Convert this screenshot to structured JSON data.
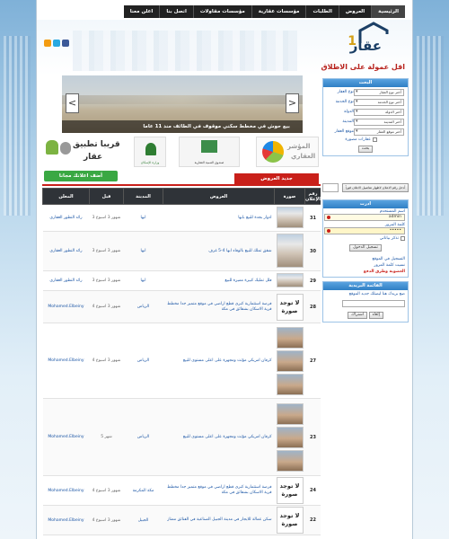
{
  "nav": {
    "items": [
      "الرئيسية",
      "العروض",
      "الطلبات",
      "مؤسسات عقارية",
      "مؤسسات مقاولات",
      "اتصل بنا",
      "اعلن معنا"
    ]
  },
  "header": {
    "logo_text": "عقار",
    "logo_number": "1",
    "slogan": "اقل عمولة على الاطلاق"
  },
  "slider": {
    "caption": "بيع حوش في مخطط سكني موقوف في الطائف منذ 11 عاما",
    "prev_arrow": "<",
    "next_arrow": ">"
  },
  "promos": {
    "app_line1": "قريبا تطبيق",
    "app_line2": "عقار",
    "seal1_caption": "وزارة الإسكان",
    "seal2_caption": "صندوق التنمية العقارية",
    "index_line1": "المؤشر",
    "index_line2": "العقاري",
    "free_ad_button": "أضف اعلانك مجانا",
    "new_offers": "جديد العروض"
  },
  "table": {
    "headers": [
      "رقم الإعلان",
      "صورة",
      "العروض",
      "المدينة",
      "قبل",
      "المعلن"
    ],
    "rows": [
      {
        "id": "31",
        "image": "photo",
        "title": "ادوار بجدة للبيع بابها",
        "city": "ابها",
        "ago": "3 شهور 3 اسبوع",
        "seller": "رائد التطور العقاري"
      },
      {
        "id": "30",
        "image": "photo",
        "title": "شقق تملك للبيع بالوفاء ابها 4-5 غرف",
        "city": "ابها",
        "ago": "3 شهور 3 اسبوع",
        "seller": "رائد التطور العقاري"
      },
      {
        "id": "29",
        "image": "photo",
        "title": "فلل تمليك كبيرة مميزة للبيع",
        "city": "ابها",
        "ago": "3 شهور 3 اسبوع",
        "seller": "رائد التطور العقاري"
      },
      {
        "id": "28",
        "image": "none",
        "title": "فرصة استثمارية كبرى قطع اراضي في موقع متميز جدا مخطط قرية الاسكان بشقائق في مكة",
        "city": "الرياض",
        "ago": "4 شهور 3 اسبوع",
        "seller": "Mohamed.Elbeiny"
      },
      {
        "id": "27",
        "image": "stack",
        "title": "كرفان امريكي مؤثث ومجهزة على اعلى مستوى للبيع",
        "city": "الرياض",
        "ago": "4 شهور 3 اسبوع",
        "seller": "Mohamed.Elbeiny"
      },
      {
        "id": "23",
        "image": "stack2",
        "title": "كرفان امريكي مؤثث ومجهزة على اعلى مستوى للبيع",
        "city": "الرياض",
        "ago": "5 شهر",
        "seller": "Mohamed.Elbeiny"
      },
      {
        "id": "24",
        "image": "none",
        "title": "فرصة استثمارية كبرى قطع اراضي في موقع متميز جدا مخطط قرية الاسكان بشقائق في مكة",
        "city": "مكة المكرمة",
        "ago": "4 شهور 3 اسبوع",
        "seller": "Mohamed.Elbeiny"
      },
      {
        "id": "22",
        "image": "none",
        "title": "سكن عمالة للايجار في مدينة الجبيل الصناعية في الفنائق ممتاز",
        "city": "الجبيل",
        "ago": "4 شهور 3 اسبوع",
        "seller": "Mohamed.Elbeiny"
      }
    ],
    "no_image_text": "لا توجد صورة"
  },
  "search_panel": {
    "title": "البحث",
    "fields": [
      {
        "label": "نوع العقار",
        "value": "أختر نوع العقار"
      },
      {
        "label": "نوع الخدمة",
        "value": "أختر نوع الخدمة"
      },
      {
        "label": "الدولة",
        "value": "أختر الدولة"
      },
      {
        "label": "المدينة",
        "value": "أختر المدينة"
      },
      {
        "label": "موقع العقار",
        "value": "أختر موقع العقار"
      }
    ],
    "images_only": "عقارات مصورة",
    "search_button": "بحث"
  },
  "ad_search": {
    "button": "أدخل رقم الاعلان لاظهار تفاصيل الاعلان فوراً"
  },
  "login_panel": {
    "title": "ادرت",
    "username_label": "اسم المستخدم",
    "username_value": "admin",
    "password_label": "كلمة المرور",
    "password_value": "•••••",
    "remember_label": "تذكر بياناتي",
    "login_button": "تسجيل الدخول",
    "register_link": "التسجيل في الموقع",
    "forgot_link": "نسيت كلمة المرور",
    "activation_link": "العضوية وطرق الدفع"
  },
  "newsletter": {
    "title": "القائمة البريدية",
    "text": "ضع بريدك هنا ليصلك جديد الموقع",
    "subscribe": "اشتراك",
    "unsubscribe": "إلغاء"
  }
}
